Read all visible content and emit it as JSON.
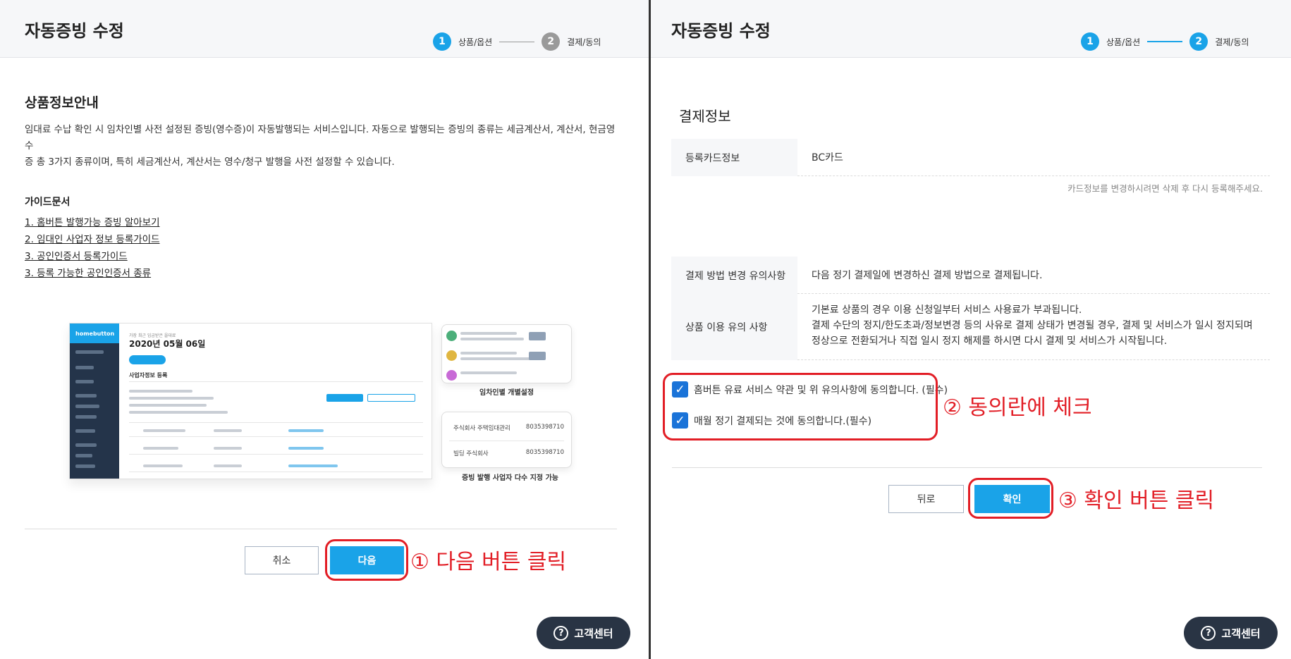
{
  "left": {
    "title": "자동증빙 수정",
    "steps": [
      {
        "num": "1",
        "label": "상품/옵션"
      },
      {
        "num": "2",
        "label": "결제/동의"
      }
    ],
    "section_title": "상품정보안내",
    "description_line1": "임대료 수납 확인 시 임차인별 사전 설정된 증빙(영수증)이 자동발행되는 서비스입니다. 자동으로 발행되는 증빙의 종류는 세금계산서, 계산서, 현금영수",
    "description_line2": "증 총 3가지 종류이며, 특히 세금계산서, 계산서는 영수/청구 발행을 사전 설정할 수 있습니다.",
    "guide_title": "가이드문서",
    "guide_links": [
      "1. 홈버튼 발행가능 증빙 알아보기",
      "2. 임대인 사업자 정보 등록가이드",
      "3. 공인인증서 등록가이드",
      "3. 등록 가능한 공인인증서 종류"
    ],
    "preview": {
      "logo": "homebutton",
      "date_small": "가장 최근 입금받은 을대료",
      "date": "2020년 05월 06일",
      "subtitle": "사업자정보 등록",
      "card_a_label": "임차인별 개별설정",
      "card_b_rows": [
        {
          "name": "주식회사 주택임대관리",
          "num": "8035398710"
        },
        {
          "name": "빌딩 주식회사",
          "num": "8035398710"
        }
      ],
      "card_b_label": "증빙 발행 사업자 다수 지정 가능"
    },
    "cancel_label": "취소",
    "next_label": "다음",
    "annotation": "① 다음 버튼 클릭",
    "help_label": "고객센터"
  },
  "right": {
    "title": "자동증빙 수정",
    "steps": [
      {
        "num": "1",
        "label": "상품/옵션"
      },
      {
        "num": "2",
        "label": "결제/동의"
      }
    ],
    "section_title": "결제정보",
    "card_label": "등록카드정보",
    "card_value": "BC카드",
    "card_note": "카드정보를 변경하시려면 삭제 후 다시 등록해주세요.",
    "change_label": "결제 방법 변경 유의사항",
    "change_value": "다음 정기 결제일에 변경하신 결제 방법으로 결제됩니다.",
    "usage_label": "상품 이용 유의 사항",
    "usage_lines": [
      "기본료 상품의 경우 이용 신청일부터 서비스 사용료가 부과됩니다.",
      "결제 수단의 정지/한도초과/정보변경 등의 사유로 결제 상태가 변경될 경우, 결제 및 서비스가 일시 정지되며",
      "정상으로 전환되거나 직접 일시 정지 해제를 하시면 다시 결제 및 서비스가 시작됩니다."
    ],
    "agree1": "홈버튼 유료 서비스 약관 및 위 유의사항에 동의합니다. (필수)",
    "agree2": "매월 정기 결제되는 것에 동의합니다.(필수)",
    "annotation_agree": "② 동의란에 체크",
    "back_label": "뒤로",
    "confirm_label": "확인",
    "annotation_confirm": "③ 확인 버튼 클릭",
    "help_label": "고객센터"
  },
  "colors": {
    "accent": "#1aa3e8",
    "annotation": "#e21e26",
    "help_bg": "#293444",
    "checkbox": "#1a73d8"
  }
}
